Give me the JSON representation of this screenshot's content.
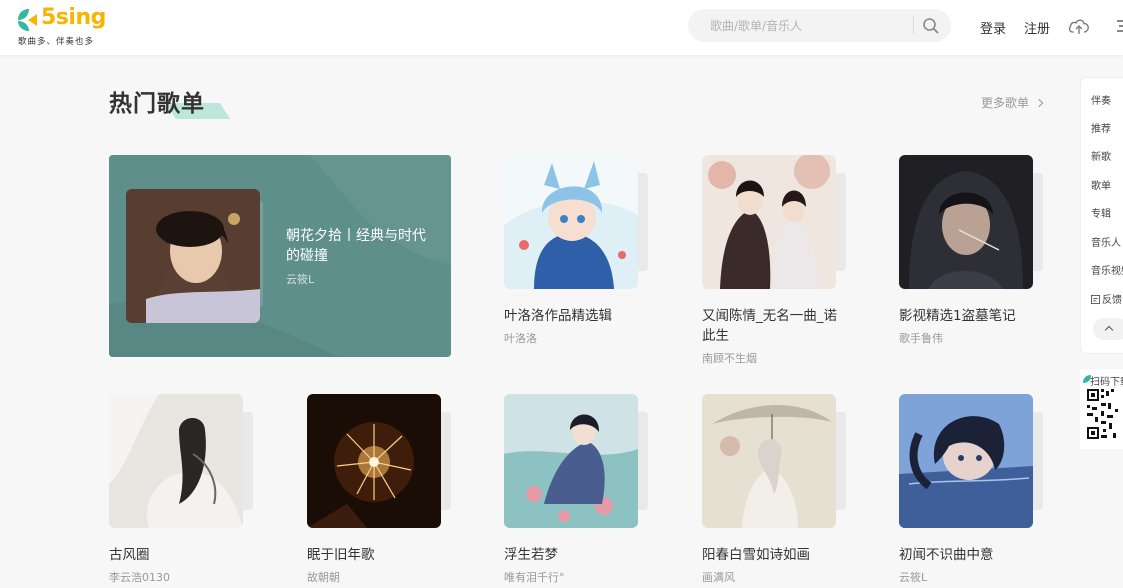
{
  "brand": {
    "name": "5sing",
    "slogan": "歌曲多、伴奏也多",
    "logo_color": "#f5b500"
  },
  "header": {
    "search_placeholder": "歌曲/歌单/音乐人",
    "login": "登录",
    "register": "注册"
  },
  "section": {
    "title": "热门歌单",
    "more": "更多歌单",
    "accent_color": "#bde7dd"
  },
  "featured": {
    "title": "朝花夕拾丨经典与时代的碰撞",
    "author": "云筱L"
  },
  "playlists": [
    {
      "title": "叶洛洛作品精选辑",
      "author": "叶洛洛"
    },
    {
      "title": "又闻陈情_无名一曲_诺此生",
      "author": "南顾不生烟"
    },
    {
      "title": "影视精选1盗墓笔记",
      "author": "歌手鲁伟"
    },
    {
      "title": "古风圈",
      "author": "李云浩0130"
    },
    {
      "title": "眠于旧年歌",
      "author": "故朝朝"
    },
    {
      "title": "浮生若梦",
      "author": "唯有泪千行°"
    },
    {
      "title": "阳春白雪如诗如画",
      "author": "画满风"
    },
    {
      "title": "初闻不识曲中意",
      "author": "云筱L"
    }
  ],
  "side_nav": {
    "items": [
      "伴奏",
      "推荐",
      "新歌",
      "歌单",
      "专辑",
      "音乐人",
      "音乐视频",
      "反馈"
    ],
    "qr_label": "扫码下载"
  }
}
